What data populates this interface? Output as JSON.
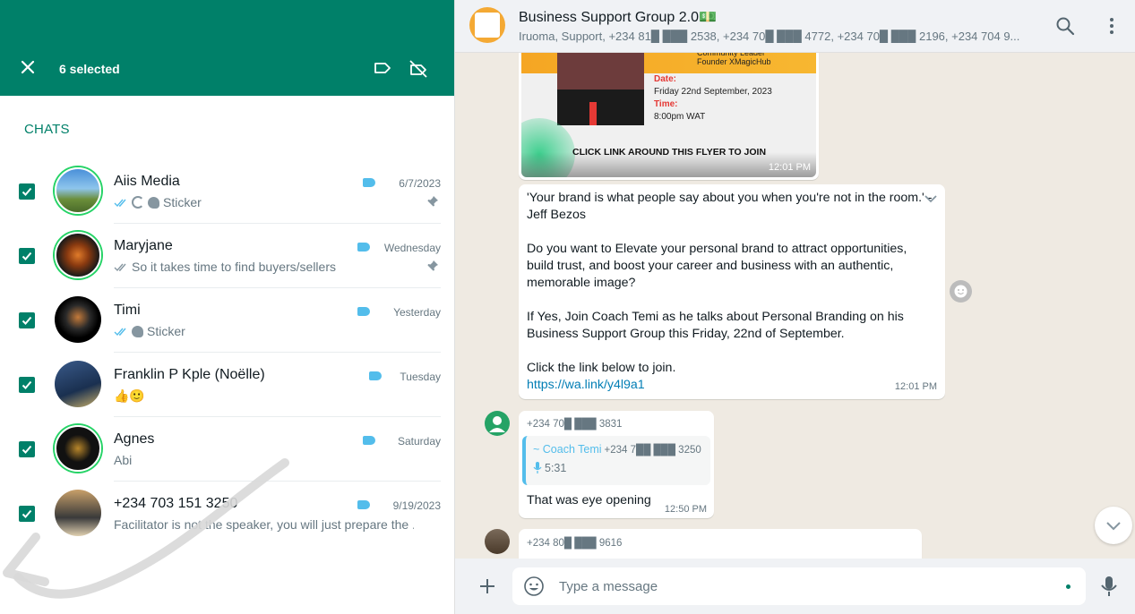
{
  "colors": {
    "brand": "#008069",
    "tag": "#53bdeb",
    "ring": "#25d366",
    "link": "#027eb5"
  },
  "selection_header": {
    "count_label": "6 selected",
    "close_icon": "close-icon",
    "label_icon": "label-icon",
    "remove_label_icon": "label-off-icon"
  },
  "section_title": "CHATS",
  "chats": [
    {
      "name": "Aiis Media",
      "time": "6/7/2023",
      "preview": "Sticker",
      "ticks": "read",
      "status_icon": true,
      "sticker": true,
      "pinned": true,
      "checked": true,
      "ring": true
    },
    {
      "name": "Maryjane",
      "time": "Wednesday",
      "preview": "So it takes time to find buyers/sellers",
      "ticks": "delivered",
      "pinned": true,
      "checked": true,
      "ring": true
    },
    {
      "name": "Timi",
      "time": "Yesterday",
      "preview": "Sticker",
      "ticks": "read",
      "sticker": true,
      "pinned": false,
      "checked": true,
      "ring": false
    },
    {
      "name": "Franklin P Kple (Noëlle)",
      "time": "Tuesday",
      "preview": "👍🙂",
      "pinned": false,
      "checked": true,
      "ring": false
    },
    {
      "name": "Agnes",
      "time": "Saturday",
      "preview": "Abi",
      "pinned": false,
      "checked": true,
      "ring": true
    },
    {
      "name": "+234 703 151 3250",
      "time": "9/19/2023",
      "preview": "Facilitator is not the speaker, you will just prepare the ...",
      "pinned": false,
      "checked": true,
      "ring": false
    }
  ],
  "conversation": {
    "title": "Business Support Group 2.0💵",
    "subtitle": "Iruoma, Support, +234 81█ ███ 2538, +234 70█ ███ 4772, +234 70█ ███ 2196, +234 704 9...",
    "search_icon": "search-icon",
    "menu_icon": "kebab-menu-icon"
  },
  "messages": {
    "flyer": {
      "host_line1": "Community Leader",
      "host_line2": "Founder XMagicHub",
      "date_label": "Date:",
      "date_value": "Friday 22nd September, 2023",
      "time_label": "Time:",
      "time_value": "8:00pm WAT",
      "cta": "CLICK LINK AROUND THIS FLYER TO JOIN",
      "timestamp": "12:01 PM"
    },
    "announcement": {
      "text": "'Your brand is what people say about you when you're not in the room.' - Jeff Bezos\n\nDo you want to Elevate your personal brand to attract opportunities, build trust, and boost your career and business with an authentic, memorable image?\n\nIf Yes, Join Coach Temi as he talks about Personal Branding on his Business Support Group this Friday, 22nd of September.\n\nClick the link below to join.",
      "link": "https://wa.link/y4l9a1",
      "timestamp": "12:01 PM"
    },
    "reply": {
      "sender": "+234 70█ ███ 3831",
      "quoted_name": "~ Coach Temi",
      "quoted_number": "+234 7██ ███ 3250",
      "voice_duration": "5:31",
      "text": "That was eye opening",
      "timestamp": "12:50 PM"
    },
    "next": {
      "sender": "+234 80█ ███ 9616"
    }
  },
  "composer": {
    "placeholder": "Type a message",
    "value": ""
  }
}
